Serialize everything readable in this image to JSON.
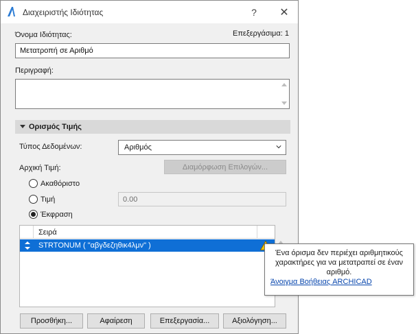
{
  "window": {
    "title": "Διαχειριστής Ιδιότητας",
    "help_label": "?",
    "close_label": "✕"
  },
  "property": {
    "name_label": "Όνομα Ιδιότητας:",
    "version_label": "Επεξεργάσιμα: 1",
    "name_value": "Μετατροπή σε Αριθμό",
    "description_label": "Περιγραφή:",
    "description_value": ""
  },
  "value_definition": {
    "header": "Ορισμός Τιμής",
    "data_type_label": "Τύπος Δεδομένων:",
    "data_type_value": "Αριθμός",
    "default_value_label": "Αρχική Τιμή:",
    "configure_options_button": "Διαμόρφωση Επιλογών...",
    "radio_undefined": "Ακαθόριστο",
    "radio_value": "Τιμή",
    "value_field": "0.00",
    "radio_expression": "Έκφραση",
    "selected_option": "Έκφραση"
  },
  "expression_table": {
    "column_header": "Σειρά",
    "rows": [
      {
        "text": "STRTONUM ( \"αβγδεζηθικ4λμν\" )",
        "has_warning": true
      }
    ]
  },
  "tooltip": {
    "message": "Ένα όρισμα δεν περιέχει αριθμητικούς χαρακτήρες για να μετατραπεί σε έναν αριθμό.",
    "link": "Άνοιγμα Βοήθειας ARCHICAD"
  },
  "footer_buttons": {
    "add": "Προσθήκη...",
    "remove": "Αφαίρεση",
    "edit": "Επεξεργασία...",
    "evaluate": "Αξιολόγηση..."
  },
  "colors": {
    "selection": "#0f6fd6",
    "warning": "#f5c400",
    "link": "#0645ad"
  }
}
